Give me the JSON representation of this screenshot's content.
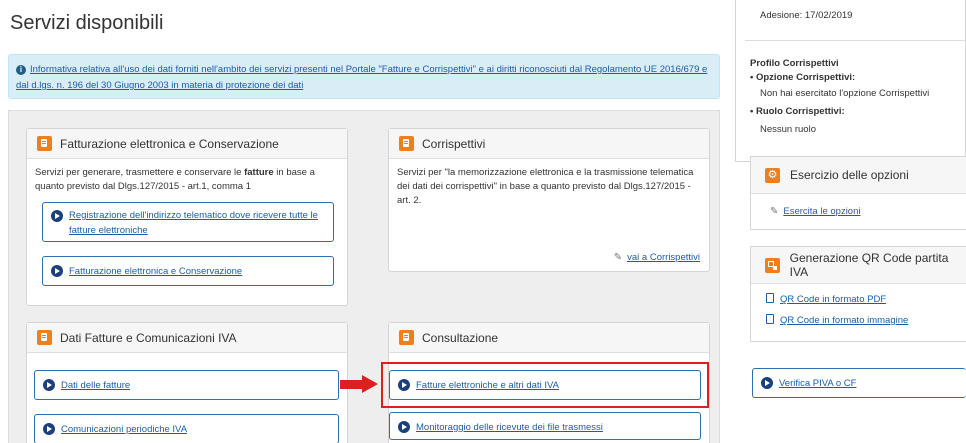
{
  "page": {
    "title": "Servizi disponibili"
  },
  "info": {
    "text": "Informativa relativa all'uso dei dati forniti nell'ambito dei servizi presenti nel Portale \"Fatture e Corrispettivi\" e ai diritti riconosciuti dal Regolamento UE 2016/679 e dal d.lgs. n. 196 del 30 Giugno 2003 in materia di protezione dei dati"
  },
  "panels": {
    "fatturazione": {
      "title": "Fatturazione elettronica e Conservazione",
      "desc_before": "Servizi per generare, trasmettere e conservare le ",
      "desc_bold": "fatture",
      "desc_after": " in base a quanto previsto dal Dlgs.127/2015 - art.1, comma 1",
      "btn1": "Registrazione dell'indirizzo telematico dove ricevere tutte le fatture elettroniche",
      "btn2": "Fatturazione elettronica e Conservazione"
    },
    "corrispettivi": {
      "title": "Corrispettivi",
      "desc": "Servizi per \"la memorizzazione elettronica e la trasmissione telematica dei dati dei corrispettivi\" in base a quanto previsto dal Dlgs.127/2015 - art. 2.",
      "link": "vai a Corrispettivi"
    },
    "dati_fatture": {
      "title": "Dati Fatture e Comunicazioni IVA",
      "btn1": "Dati delle fatture",
      "btn2": "Comunicazioni periodiche IVA"
    },
    "consultazione": {
      "title": "Consultazione",
      "btn1": "Fatture elettroniche e altri dati IVA",
      "btn2": "Monitoraggio delle ricevute dei file trasmessi"
    }
  },
  "sidebar": {
    "adesione": "Adesione: 17/02/2019",
    "profilo_title": "Profilo Corrispettivi",
    "opzione_label": "Opzione Corrispettivi:",
    "opzione_value": "Non hai esercitato l'opzione Corrispettivi",
    "ruolo_label": "Ruolo Corrispettivi:",
    "ruolo_value": "Nessun ruolo",
    "esercizio_title": "Esercizio delle opzioni",
    "esercizio_link": "Esercita le opzioni",
    "qr_title": "Generazione QR Code partita IVA",
    "qr_pdf": "QR Code in formato PDF",
    "qr_img": "QR Code in formato immagine",
    "verifica": "Verifica PIVA o CF"
  },
  "colors": {
    "accent_orange": "#f07f1a",
    "link_blue": "#1a5ea8",
    "highlight_red": "#e01e1e",
    "info_bg": "#d9edf7"
  }
}
